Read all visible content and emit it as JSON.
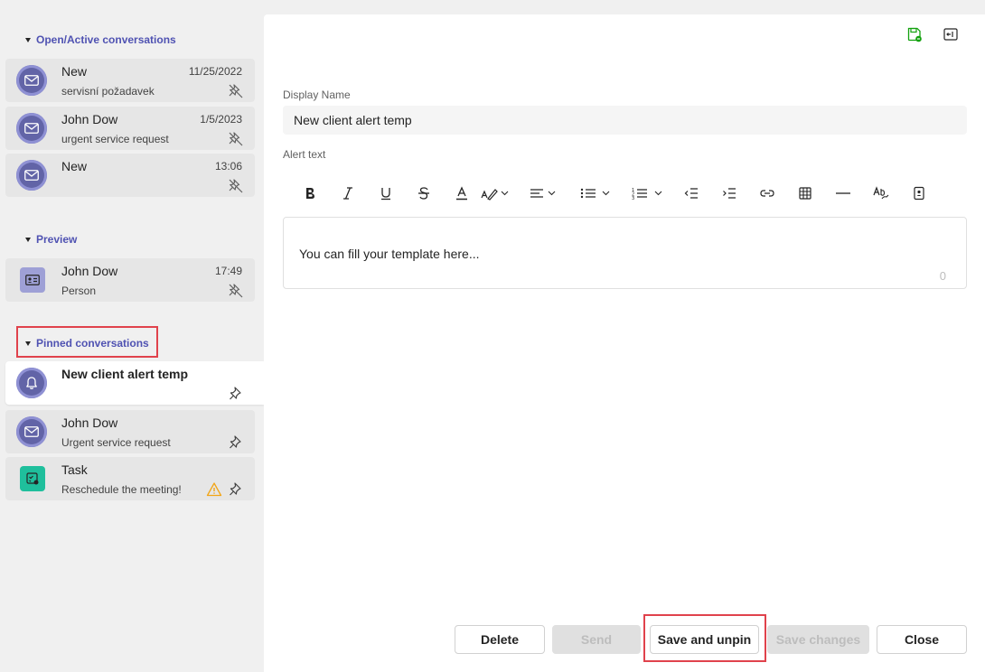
{
  "sections": {
    "open": {
      "label": "Open/Active conversations"
    },
    "preview": {
      "label": "Preview"
    },
    "pinned": {
      "label": "Pinned conversations"
    }
  },
  "open_items": [
    {
      "title": "New",
      "subtitle": "servisní požadavek",
      "date": "11/25/2022",
      "icon": "mail-icon"
    },
    {
      "title": "John Dow",
      "subtitle": "urgent service request",
      "date": "1/5/2023",
      "icon": "mail-icon"
    },
    {
      "title": "New",
      "subtitle": "",
      "date": "13:06",
      "icon": "mail-icon"
    }
  ],
  "preview_items": [
    {
      "title": "John Dow",
      "subtitle": "Person",
      "date": "17:49",
      "icon": "contact-card-icon"
    }
  ],
  "pinned_items": [
    {
      "title": "New client alert temp",
      "subtitle": "",
      "icon": "bell-icon"
    },
    {
      "title": "John Dow",
      "subtitle": "Urgent service request",
      "icon": "mail-icon"
    },
    {
      "title": "Task",
      "subtitle": "Reschedule the meeting!",
      "icon": "task-icon"
    }
  ],
  "form": {
    "display_name_label": "Display Name",
    "display_name_value": "New client alert temp",
    "alert_text_label": "Alert text",
    "editor_placeholder": "You can fill your template here...",
    "char_count": "0"
  },
  "buttons": {
    "delete": "Delete",
    "send": "Send",
    "save_unpin": "Save and unpin",
    "save_changes": "Save changes",
    "close": "Close"
  },
  "colors": {
    "accent": "#4f52b2",
    "avatar": "#6264a7",
    "task": "#1fbf9c",
    "highlight": "#e0424c",
    "warning": "#f2a516",
    "save_icon": "#13a10e"
  }
}
